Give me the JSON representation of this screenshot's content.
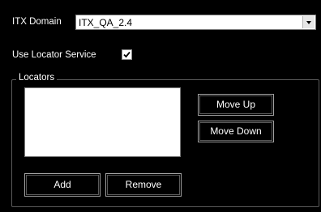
{
  "domain_label": "ITX Domain",
  "domain_value": "ITX_QA_2.4",
  "locator_label": "Use Locator Service",
  "locator_checked": true,
  "locators": {
    "title": "Locators",
    "items": [],
    "move_up": "Move Up",
    "move_down": "Move Down",
    "add": "Add",
    "remove": "Remove"
  },
  "icons": {
    "dropdown": "chevron-down-icon",
    "check": "check-icon"
  }
}
